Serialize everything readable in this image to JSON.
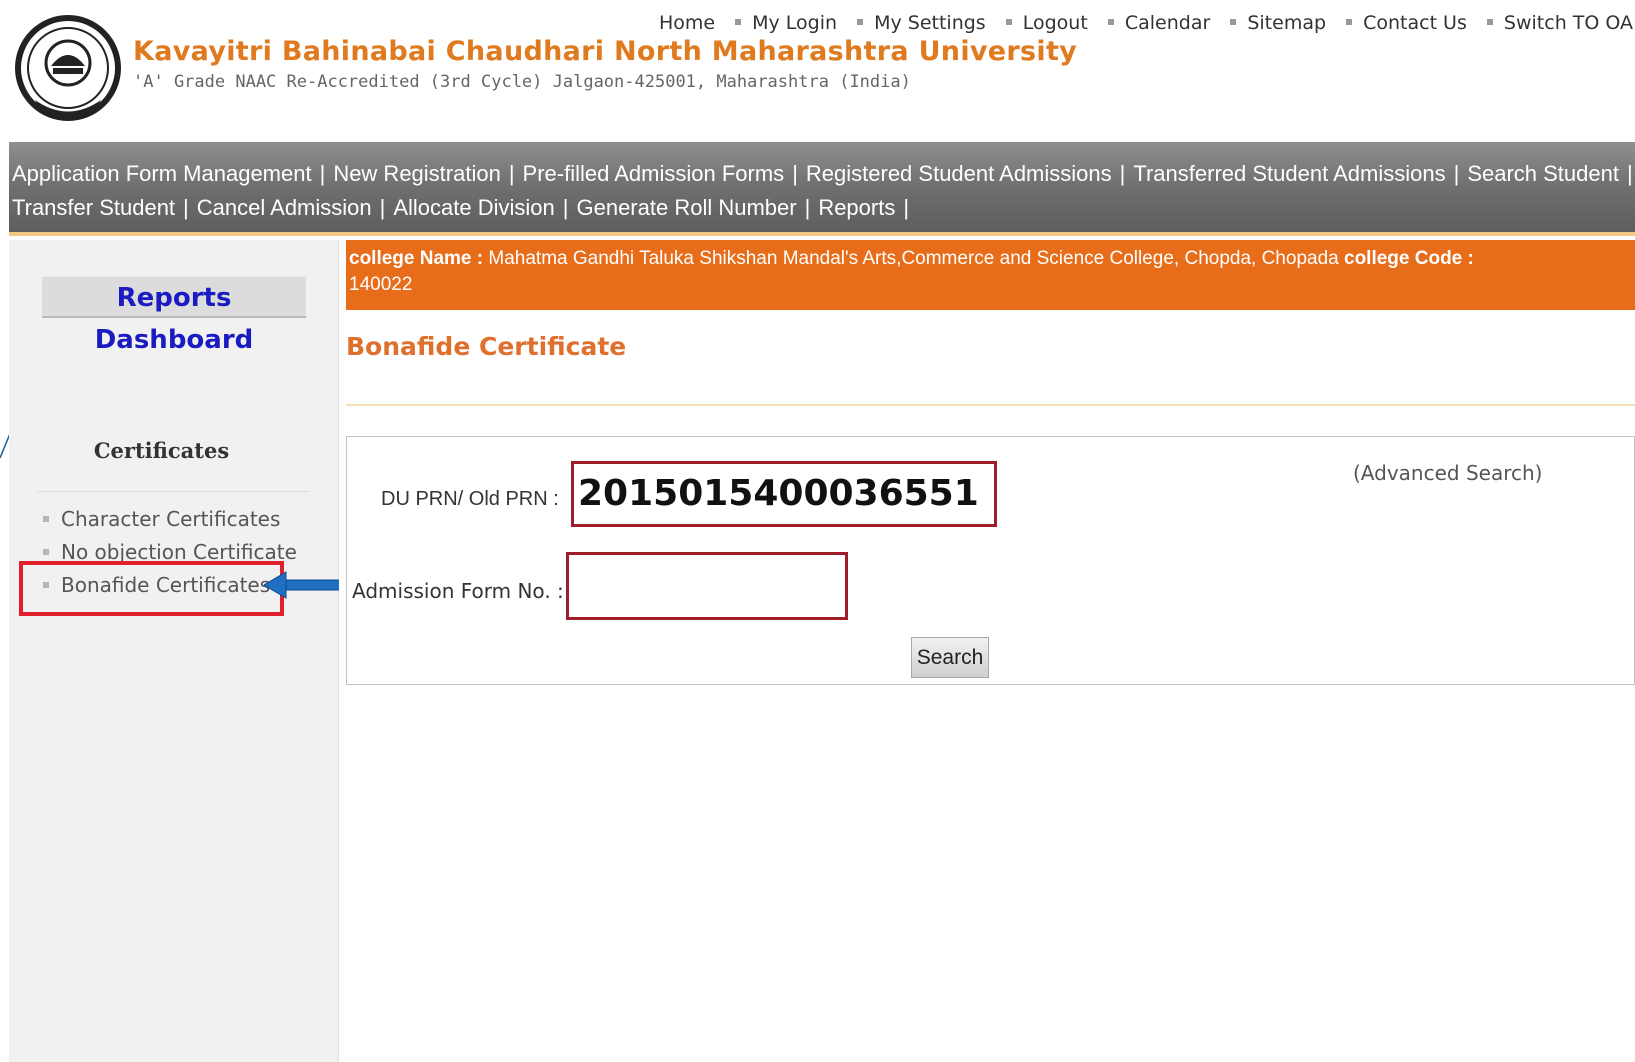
{
  "header": {
    "title": "Kavayitri Bahinabai Chaudhari North Maharashtra University",
    "subtitle": "'A' Grade NAAC Re-Accredited (3rd Cycle) Jalgaon-425001, Maharashtra (India)",
    "top_links": [
      "Home",
      "My Login",
      "My Settings",
      "Logout",
      "Calendar",
      "Sitemap",
      "Contact Us",
      "Switch TO OA"
    ]
  },
  "nav": {
    "row1": [
      "Application Form Management",
      "New Registration",
      "Pre-filled Admission Forms",
      "Registered Student Admissions",
      "Transferred Student Admissions",
      "Search Student"
    ],
    "row2": [
      "Transfer Student",
      "Cancel Admission",
      "Allocate Division",
      "Generate Roll Number",
      "Reports"
    ],
    "separator": "|"
  },
  "sidebar": {
    "dashboard_label": "Reports Dashboard",
    "section_title": "Certificates",
    "items": [
      "Character Certificates",
      "No objection Certificate",
      "Bonafide Certificates"
    ]
  },
  "college": {
    "name_label": "college Name :",
    "name": "Mahatma Gandhi Taluka Shikshan Mandal's Arts,Commerce and Science College, Chopda, Chopada",
    "code_label": "college Code :",
    "code": "140022"
  },
  "main": {
    "heading": "Bonafide Certificate",
    "prn_label": "DU PRN/ Old PRN :",
    "prn_value": "2015015400036551",
    "admission_label": "Admission Form No. :",
    "admission_value": "",
    "advanced_search": "(Advanced Search)",
    "search_button": "Search"
  },
  "colors": {
    "title_orange": "#e07a1f",
    "college_bar": "#e86d1a",
    "highlight_red": "#e0202c",
    "arrow_blue": "#1f6fc2",
    "dashboard_blue": "#1b1bc2"
  }
}
